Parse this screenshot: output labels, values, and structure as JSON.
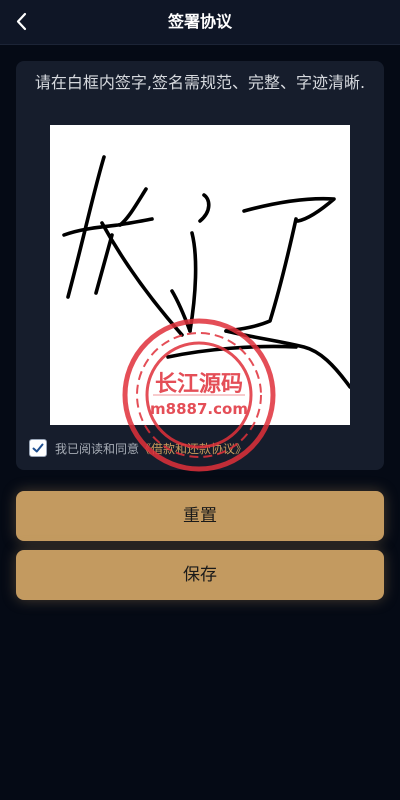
{
  "header": {
    "title": "签署协议",
    "back_icon": "chevron-left-icon"
  },
  "signature": {
    "instructions": "请在白框内签字,签名需规范、完整、字迹清晰."
  },
  "agreement": {
    "prefix": "我已阅读和同意",
    "link": "《借款和还款协议》",
    "checked": true
  },
  "watermark": {
    "title": "长江源码",
    "url": "m8887.com"
  },
  "buttons": {
    "reset": "重置",
    "save": "保存"
  },
  "colors": {
    "background": "#050a15",
    "navbar": "#0f1626",
    "card": "#161d2c",
    "button": "#c39a60",
    "link": "#c79a5c",
    "stamp": "#e0303a"
  }
}
